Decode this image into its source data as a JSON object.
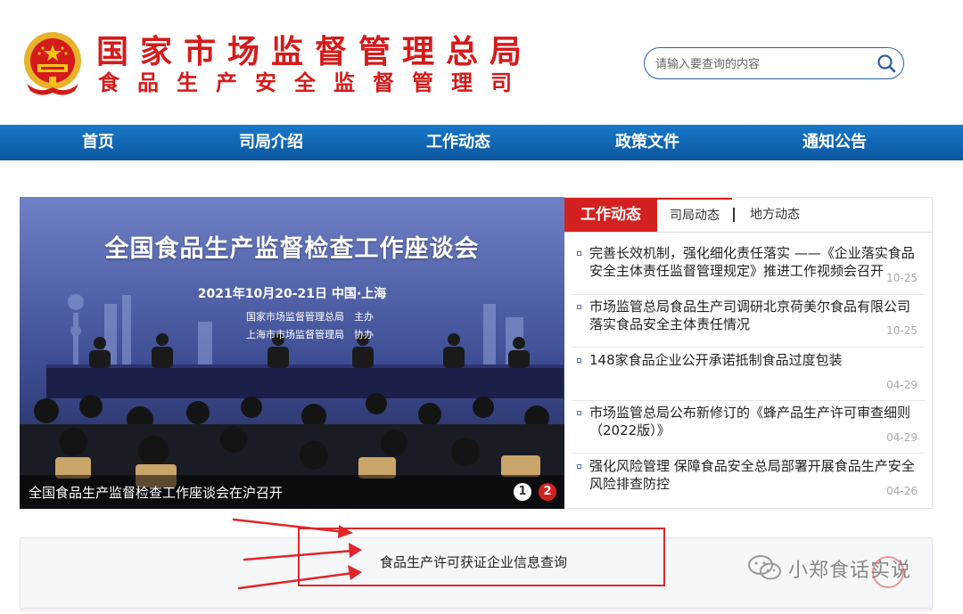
{
  "header": {
    "org_name": "国家市场监督管理总局",
    "dept_name": "食品生产安全监督管理司",
    "emblem_icon": "national-emblem-icon"
  },
  "search": {
    "placeholder": "请输入要查询的内容",
    "button_icon": "search-icon"
  },
  "nav": {
    "items": [
      "首页",
      "司局介绍",
      "工作动态",
      "政策文件",
      "通知公告"
    ]
  },
  "banner": {
    "poster_title": "全国食品生产监督检查工作座谈会",
    "poster_date": "2021年10月20-21日 中国·上海",
    "poster_organizer_1": "国家市场监督管理总局　主办",
    "poster_organizer_2": "上海市市场监督管理局　协办",
    "caption": "全国食品生产监督检查工作座谈会在沪召开",
    "pages": [
      "1",
      "2"
    ],
    "active_page": 2
  },
  "news": {
    "heading": "工作动态",
    "tabs": [
      "司局动态",
      "地方动态"
    ],
    "items": [
      {
        "title": "完善长效机制，强化细化责任落实 ——《企业落实食品安全主体责任监督管理规定》推进工作视频会召开",
        "date": "10-25"
      },
      {
        "title": "市场监管总局食品生产司调研北京荷美尔食品有限公司落实食品安全主体责任情况",
        "date": "10-25"
      },
      {
        "title": "148家食品企业公开承诺抵制食品过度包装",
        "date": "04-29"
      },
      {
        "title": "市场监管总局公布新修订的《蜂产品生产许可审查细则（2022版）》",
        "date": "04-29"
      },
      {
        "title": "强化风险管理 保障食品安全总局部署开展食品生产安全风险排查防控",
        "date": "04-26"
      }
    ]
  },
  "query": {
    "link_text": "食品生产许可获证企业信息查询"
  },
  "watermark": {
    "text": "小郑食话实说",
    "icon": "wechat-icon"
  },
  "colors": {
    "brand_red": "#d51a1a",
    "nav_blue": "#0b56a0",
    "annotation_red": "#e0262b"
  }
}
